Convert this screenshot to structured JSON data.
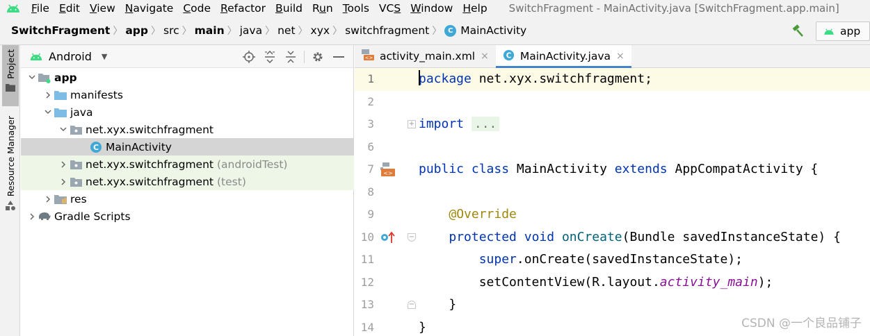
{
  "menubar": {
    "items": [
      {
        "label": "File",
        "mnemonic": "F",
        "rest": "ile"
      },
      {
        "label": "Edit",
        "mnemonic": "E",
        "rest": "dit"
      },
      {
        "label": "View",
        "mnemonic": "V",
        "rest": "iew"
      },
      {
        "label": "Navigate",
        "mnemonic": "N",
        "rest": "avigate"
      },
      {
        "label": "Code",
        "mnemonic": "C",
        "rest": "ode"
      },
      {
        "label": "Refactor",
        "mnemonic": "R",
        "rest": "efactor"
      },
      {
        "label": "Build",
        "mnemonic": "B",
        "rest": "uild"
      },
      {
        "label": "Run",
        "mnemonic": "u",
        "pre": "R",
        "rest": "n"
      },
      {
        "label": "Tools",
        "mnemonic": "T",
        "rest": "ools"
      },
      {
        "label": "VCS",
        "mnemonic": "S",
        "pre": "VC",
        "rest": ""
      },
      {
        "label": "Window",
        "mnemonic": "W",
        "rest": "indow"
      },
      {
        "label": "Help",
        "mnemonic": "H",
        "rest": "elp"
      }
    ],
    "window_title": "SwitchFragment - MainActivity.java [SwitchFragment.app.main]"
  },
  "navbar": {
    "crumbs": [
      "SwitchFragment",
      "app",
      "src",
      "main",
      "java",
      "net",
      "xyx",
      "switchfragment",
      "MainActivity"
    ],
    "class_badge": "C",
    "run_config": "app"
  },
  "toolstrip": {
    "project_label": "Project",
    "resource_label": "Resource Manager"
  },
  "project": {
    "view": "Android",
    "tree": [
      {
        "label": "app",
        "suffix": ""
      },
      {
        "label": "manifests",
        "suffix": ""
      },
      {
        "label": "java",
        "suffix": ""
      },
      {
        "label": "net.xyx.switchfragment",
        "suffix": ""
      },
      {
        "label": "MainActivity",
        "suffix": ""
      },
      {
        "label": "net.xyx.switchfragment",
        "suffix": "(androidTest)"
      },
      {
        "label": "net.xyx.switchfragment",
        "suffix": "(test)"
      },
      {
        "label": "res",
        "suffix": ""
      },
      {
        "label": "Gradle Scripts",
        "suffix": ""
      }
    ]
  },
  "editor": {
    "tabs": [
      {
        "label": "activity_main.xml",
        "close": "×"
      },
      {
        "label": "MainActivity.java",
        "close": "×"
      }
    ],
    "line_numbers": [
      "1",
      "2",
      "3",
      "6",
      "7",
      "8",
      "9",
      "10",
      "11",
      "12",
      "13",
      "14"
    ],
    "code": {
      "l1_kw": "package",
      "l1_rest": " net.xyx.switchfragment;",
      "l3_kw": "import",
      "l3_fold": "...",
      "l7_kw1": "public",
      "l7_kw2": "class",
      "l7_name": " MainActivity ",
      "l7_kw3": "extends",
      "l7_rest": " AppCompatActivity {",
      "l9_ann": "@Override",
      "l10_kw1": "protected",
      "l10_kw2": "void",
      "l10_fn": "onCreate",
      "l10_rest": "(Bundle savedInstanceState) {",
      "l11_kw": "super",
      "l11_rest": ".onCreate(savedInstanceState);",
      "l12_pre": "setContentView(R.layout.",
      "l12_field": "activity_main",
      "l12_post": ");",
      "l13": "}",
      "l14": "}"
    }
  },
  "watermark": "CSDN @一个良品铺子",
  "colors": {
    "keyword": "#0033b3",
    "annotation": "#9e880d",
    "method": "#00627a",
    "field": "#871094",
    "accent": "#4083c9",
    "android_green": "#3ddc84"
  }
}
